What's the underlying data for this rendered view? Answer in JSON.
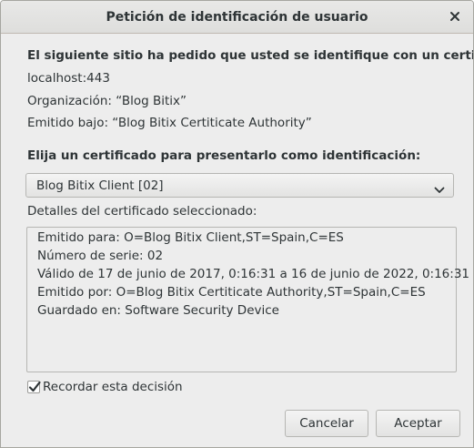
{
  "window": {
    "title": "Petición de identificación de usuario",
    "close_icon": "close-icon"
  },
  "request": {
    "heading": "El siguiente sitio ha pedido que usted se identifique con un certificado:",
    "host": "localhost:443",
    "organization": "Organización: “Blog Bitix”",
    "issued_under": "Emitido bajo: “Blog Bitix Certiticate Authority”"
  },
  "certificate": {
    "prompt": "Elija un certificado para presentarlo como identificación:",
    "selected": "Blog Bitix Client [02]",
    "details_label": "Detalles del certificado seleccionado:",
    "details_lines": [
      "Emitido para: O=Blog Bitix Client,ST=Spain,C=ES",
      "Número de serie: 02",
      "Válido de 17 de junio de 2017, 0:16:31 a 16 de junio de 2022, 0:16:31",
      "Emitido por: O=Blog Bitix Certiticate Authority,ST=Spain,C=ES",
      "Guardado en: Software Security Device"
    ]
  },
  "remember": {
    "label": "Recordar esta decisión",
    "checked": true
  },
  "buttons": {
    "cancel": "Cancelar",
    "accept": "Aceptar"
  }
}
